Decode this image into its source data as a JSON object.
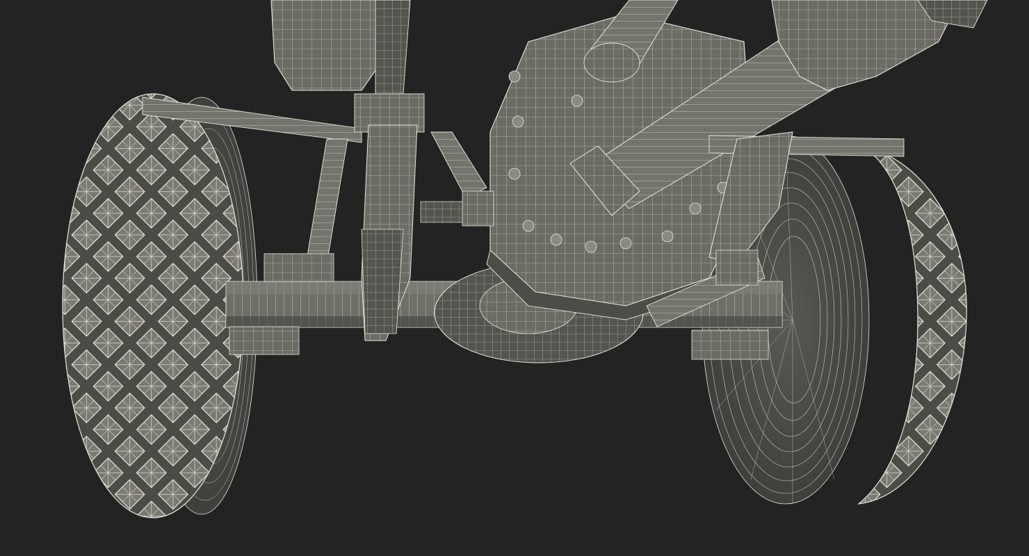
{
  "scene": {
    "subject": "wireframe-render",
    "background_color": "#232323",
    "mesh_fill_color": "#6b6b64",
    "mesh_line_color": "#e8e8dc",
    "shadow_color": "#3e3e3a"
  }
}
